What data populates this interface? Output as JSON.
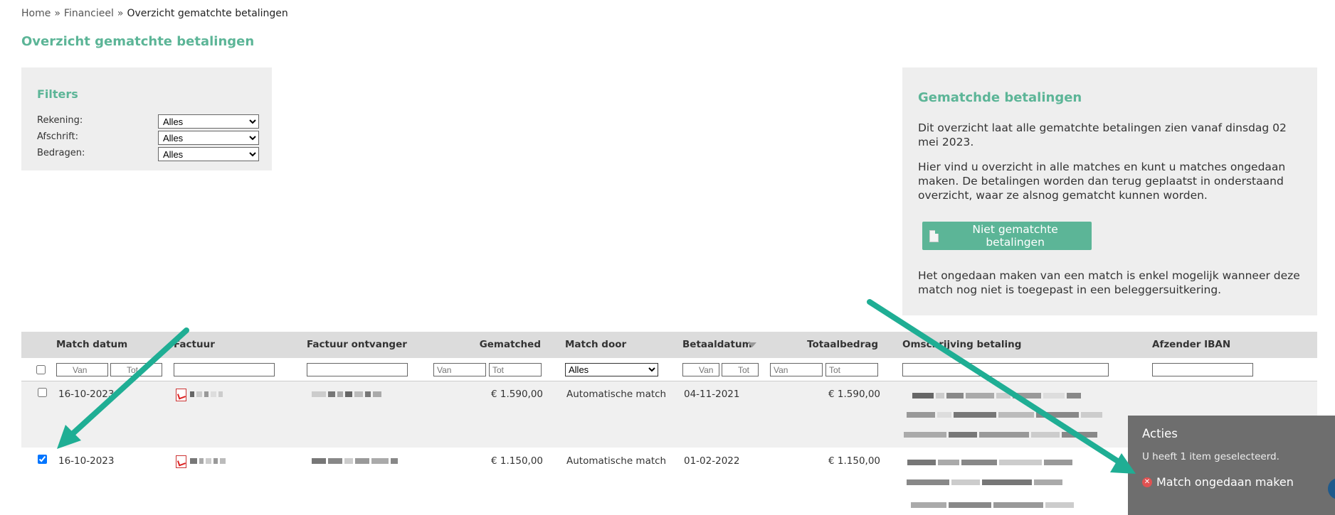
{
  "breadcrumb": {
    "home": "Home",
    "sep1": "»",
    "financieel": "Financieel",
    "sep2": "»",
    "current": "Overzicht gematchte betalingen"
  },
  "page_title": "Overzicht gematchte betalingen",
  "filters": {
    "title": "Filters",
    "rekening": {
      "label": "Rekening:",
      "value": "Alles"
    },
    "afschrift": {
      "label": "Afschrift:",
      "value": "Alles"
    },
    "bedragen": {
      "label": "Bedragen:",
      "value": "Alles"
    }
  },
  "info": {
    "title": "Gematchde betalingen",
    "p1": "Dit overzicht laat alle gematchte betalingen zien vanaf dinsdag 02 mei 2023.",
    "p2": "Hier vind u overzicht in alle matches en kunt u matches ongedaan maken. De betalingen worden dan terug geplaatst in onderstaand overzicht, waar ze alsnog gematcht kunnen worden.",
    "button": "Niet gematchte betalingen",
    "p3": "Het ongedaan maken van een match is enkel mogelijk wanneer deze match nog niet is toegepast in een beleggersuitkering."
  },
  "table": {
    "headers": {
      "match_datum": "Match datum",
      "factuur": "Factuur",
      "ontvanger": "Factuur ontvanger",
      "gematched": "Gematched",
      "match_door": "Match door",
      "betaaldatum": "Betaaldatum",
      "totaalbedrag": "Totaalbedrag",
      "omschrijving": "Omschrijving betaling",
      "iban": "Afzender IBAN"
    },
    "filter_placeholders": {
      "van": "Van",
      "tot": "Tot"
    },
    "match_door_filter": "Alles",
    "rows": [
      {
        "selected": false,
        "match_datum": "16-10-2023",
        "gematched": "€ 1.590,00",
        "match_door": "Automatische match",
        "betaaldatum": "04-11-2021",
        "totaalbedrag": "€ 1.590,00"
      },
      {
        "selected": true,
        "match_datum": "16-10-2023",
        "gematched": "€ 1.150,00",
        "match_door": "Automatische match",
        "betaaldatum": "01-02-2022",
        "totaalbedrag": "€ 1.150,00"
      }
    ]
  },
  "acties": {
    "title": "Acties",
    "selection_prefix": "U heeft",
    "selection_count": "1",
    "selection_suffix": "item geselecteerd.",
    "undo": "Match ongedaan maken"
  },
  "colors": {
    "accent": "#5cb597",
    "arrow": "#1fae94",
    "panel": "#eeeeee",
    "acties_bg": "#6e6e6e"
  }
}
